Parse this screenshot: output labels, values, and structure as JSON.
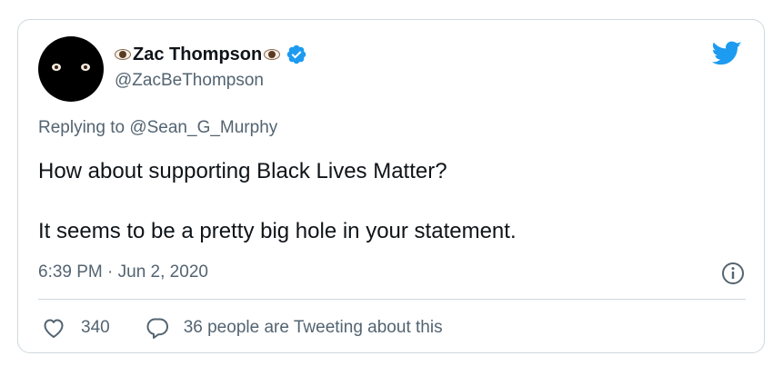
{
  "tweet": {
    "author": {
      "display_name": "Zac Thompson",
      "name_emoji": "eye-emoji",
      "handle": "@ZacBeThompson",
      "verified": true,
      "avatar": "black-avatar-with-eyes"
    },
    "replying_to": "Replying to @Sean_G_Murphy",
    "text": [
      "How about supporting Black Lives Matter?",
      "It seems to be a pretty big hole in your statement."
    ],
    "timestamp": "6:39 PM · Jun 2, 2020",
    "likes": "340",
    "conversation": "36 people are Tweeting about this"
  },
  "icons": {
    "brand": "twitter-bird-icon",
    "verified": "verified-badge-icon",
    "info": "info-icon",
    "like": "heart-icon",
    "reply": "reply-bubble-icon"
  },
  "colors": {
    "brand_blue": "#1d9bf0",
    "text_primary": "#0f1419",
    "text_secondary": "#536471",
    "border": "#cfd9de"
  }
}
